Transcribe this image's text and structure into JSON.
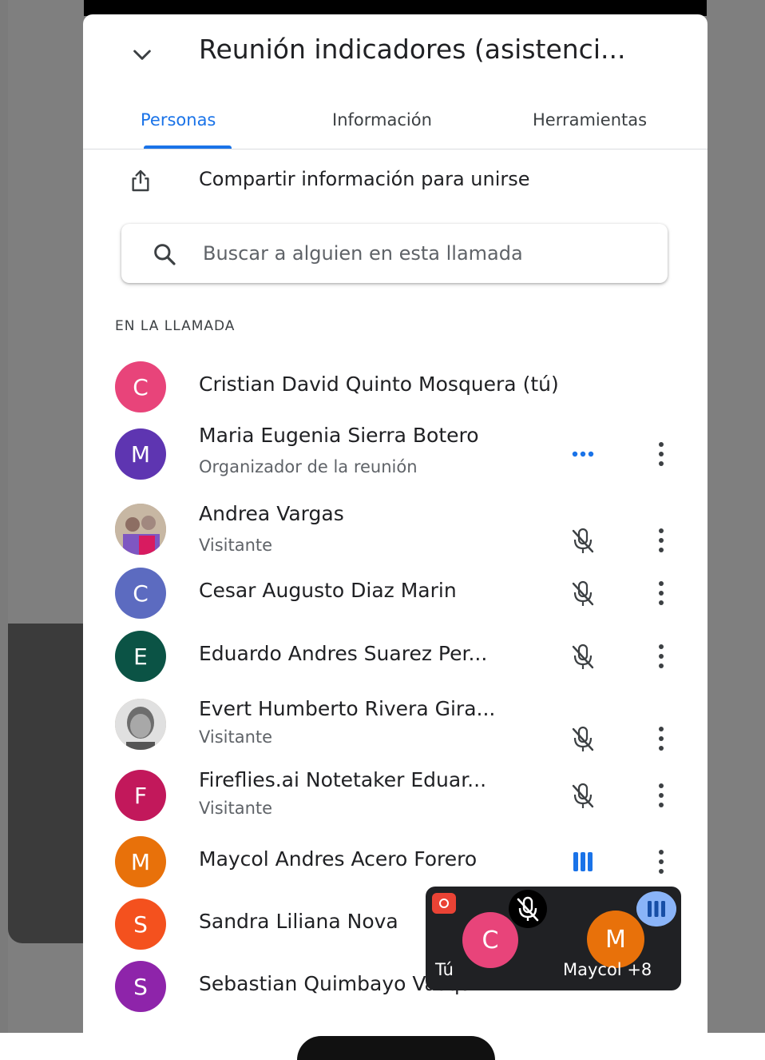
{
  "meeting": {
    "title": "Reunión indicadores (asistenci..."
  },
  "tabs": [
    {
      "label": "Personas",
      "active": true
    },
    {
      "label": "Información",
      "active": false
    },
    {
      "label": "Herramientas",
      "active": false
    }
  ],
  "share": {
    "label": "Compartir información para unirse",
    "icon": "share-icon"
  },
  "search": {
    "placeholder": "Buscar a alguien en esta llamada",
    "value": ""
  },
  "section": {
    "label": "EN LA LLAMADA"
  },
  "participants": [
    {
      "initial": "C",
      "name": "Cristian David Quinto Mosquera (tú)",
      "subtitle": "",
      "color": "#e8447a",
      "status": "none"
    },
    {
      "initial": "M",
      "name": "Maria Eugenia Sierra Botero",
      "subtitle": "Organizador de la reunión",
      "color": "#5e35b1",
      "status": "more-dots-icon"
    },
    {
      "initial": "",
      "name": "Andrea Vargas",
      "subtitle": "Visitante",
      "color": "#b9a48e",
      "status": "mic-off-icon",
      "photo": true
    },
    {
      "initial": "C",
      "name": "Cesar Augusto Diaz Marin",
      "subtitle": "",
      "color": "#5c6bc0",
      "status": "mic-off-icon"
    },
    {
      "initial": "E",
      "name": "Eduardo Andres Suarez Per...",
      "subtitle": "",
      "color": "#0b5345",
      "status": "mic-off-icon"
    },
    {
      "initial": "",
      "name": "Evert Humberto Rivera Gira...",
      "subtitle": "Visitante",
      "color": "#9e9e9e",
      "status": "mic-off-icon",
      "photo": true
    },
    {
      "initial": "F",
      "name": "Fireflies.ai Notetaker Eduar...",
      "subtitle": "Visitante",
      "color": "#c2185b",
      "status": "mic-off-icon"
    },
    {
      "initial": "M",
      "name": "Maycol Andres Acero Forero",
      "subtitle": "",
      "color": "#e8710a",
      "status": "speaking-icon"
    },
    {
      "initial": "S",
      "name": "Sandra Liliana Nova",
      "subtitle": "",
      "color": "#f4511e",
      "status": "mic-off-icon"
    },
    {
      "initial": "S",
      "name": "Sebastian Quimbayo Vasqu...",
      "subtitle": "",
      "color": "#8e24aa",
      "status": "mic-off-icon"
    }
  ],
  "pip": {
    "self_initial": "C",
    "self_label": "Tú",
    "other_initial": "M",
    "other_label": "Maycol +8"
  },
  "colors": {
    "accent": "#1a73e8",
    "text_primary": "#202124",
    "text_secondary": "#5f6368"
  }
}
